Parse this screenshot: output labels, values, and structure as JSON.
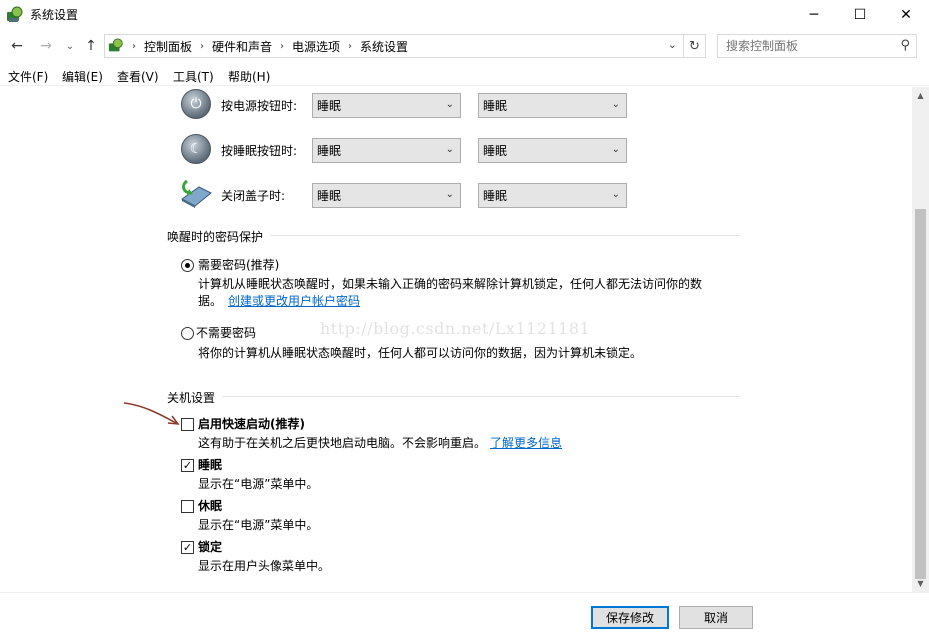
{
  "window": {
    "title": "系统设置",
    "minimize": "─",
    "maximize": "☐",
    "close": "✕"
  },
  "nav": {
    "back": "←",
    "forward": "→",
    "recent": "⌄",
    "up": "↑",
    "breadcrumbs": [
      "控制面板",
      "硬件和声音",
      "电源选项",
      "系统设置"
    ],
    "dropdown": "⌄",
    "refresh": "↻",
    "search_placeholder": "搜索控制面板",
    "search_icon": "⚲"
  },
  "menu": [
    "文件(F)",
    "编辑(E)",
    "查看(V)",
    "工具(T)",
    "帮助(H)"
  ],
  "power_buttons": {
    "rows": [
      {
        "label": "按电源按钮时:",
        "battery": "睡眠",
        "plugged": "睡眠",
        "icon": "power-button-icon"
      },
      {
        "label": "按睡眠按钮时:",
        "battery": "睡眠",
        "plugged": "睡眠",
        "icon": "sleep-button-icon"
      },
      {
        "label": "关闭盖子时:",
        "battery": "睡眠",
        "plugged": "睡眠",
        "icon": "laptop-lid-icon"
      }
    ]
  },
  "wake_password": {
    "title": "唤醒时的密码保护",
    "require": {
      "label": "需要密码(推荐)",
      "desc1": "计算机从睡眠状态唤醒时，如果未输入正确的密码来解除计算机锁定，任何人都无法访问你的数",
      "desc2_prefix": "据。",
      "link": "创建或更改用户帐户密码",
      "checked": true
    },
    "norequire": {
      "label": "不需要密码",
      "desc": "将你的计算机从睡眠状态唤醒时，任何人都可以访问你的数据，因为计算机未锁定。",
      "checked": false
    }
  },
  "watermark": "http://blog.csdn.net/Lx1121181",
  "shutdown": {
    "title": "关机设置",
    "items": [
      {
        "label": "启用快速启动(推荐)",
        "desc": "这有助于在关机之后更快地启动电脑。不会影响重启。",
        "link": "了解更多信息",
        "checked": false
      },
      {
        "label": "睡眠",
        "desc": "显示在“电源”菜单中。",
        "checked": true
      },
      {
        "label": "休眠",
        "desc": "显示在“电源”菜单中。",
        "checked": false
      },
      {
        "label": "锁定",
        "desc": "显示在用户头像菜单中。",
        "checked": true
      }
    ]
  },
  "footer": {
    "save": "保存修改",
    "cancel": "取消"
  },
  "colors": {
    "link": "#0066cc",
    "primary_border": "#0078d7",
    "annotation_arrow": "#8b3a2a"
  }
}
